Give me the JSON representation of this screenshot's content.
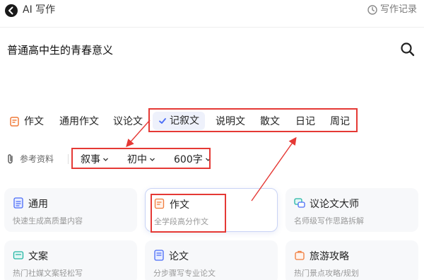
{
  "header": {
    "title": "AI 写作",
    "history_label": "写作记录"
  },
  "query": {
    "text": "普通高中生的青春意义"
  },
  "type_tabs": {
    "items": [
      {
        "label": "作文"
      },
      {
        "label": "通用作文"
      },
      {
        "label": "议论文"
      },
      {
        "label": "记叙文",
        "selected": true
      },
      {
        "label": "说明文"
      },
      {
        "label": "散文"
      },
      {
        "label": "日记"
      },
      {
        "label": "周记"
      }
    ]
  },
  "reference": {
    "label": "参考资料",
    "dropdowns": [
      {
        "value": "叙事"
      },
      {
        "value": "初中"
      },
      {
        "value": "600字"
      }
    ]
  },
  "cards": [
    {
      "title": "通用",
      "desc": "快速生成高质量内容",
      "icon": "document-icon",
      "color": "#4a6cf7"
    },
    {
      "title": "作文",
      "desc": "全学段高分作文",
      "icon": "pen-note-icon",
      "color": "#f07b3a",
      "active": true
    },
    {
      "title": "议论文大师",
      "desc": "名师级写作思路拆解",
      "icon": "debate-icon",
      "color": "#22b5a4"
    },
    {
      "title": "文案",
      "desc": "热门社媒文案轻松写",
      "icon": "copywriting-icon",
      "color": "#22b5a4"
    },
    {
      "title": "论文",
      "desc": "分步骤写专业论文",
      "icon": "paper-icon",
      "color": "#4a6cf7"
    },
    {
      "title": "旅游攻略",
      "desc": "热门景点攻略/规划",
      "icon": "travel-icon",
      "color": "#f07b3a"
    }
  ],
  "colors": {
    "accent": "#4a6cf7",
    "annotation": "#e53935"
  }
}
